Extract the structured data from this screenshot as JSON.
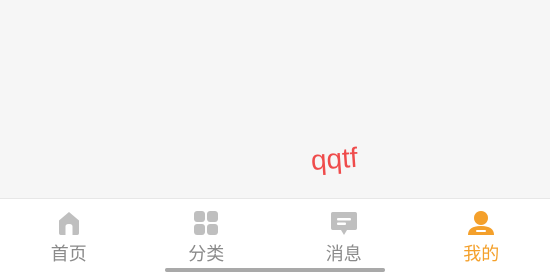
{
  "watermark": {
    "text": "qqtf",
    "color": "#ef4b4b"
  },
  "tabbar": {
    "inactive_color": "#bfbfbf",
    "active_color": "#f4a02b",
    "tabs": [
      {
        "label": "首页",
        "icon": "home-icon",
        "active": false
      },
      {
        "label": "分类",
        "icon": "category-grid-icon",
        "active": false
      },
      {
        "label": "消息",
        "icon": "message-icon",
        "active": false
      },
      {
        "label": "我的",
        "icon": "profile-icon",
        "active": true
      }
    ]
  }
}
